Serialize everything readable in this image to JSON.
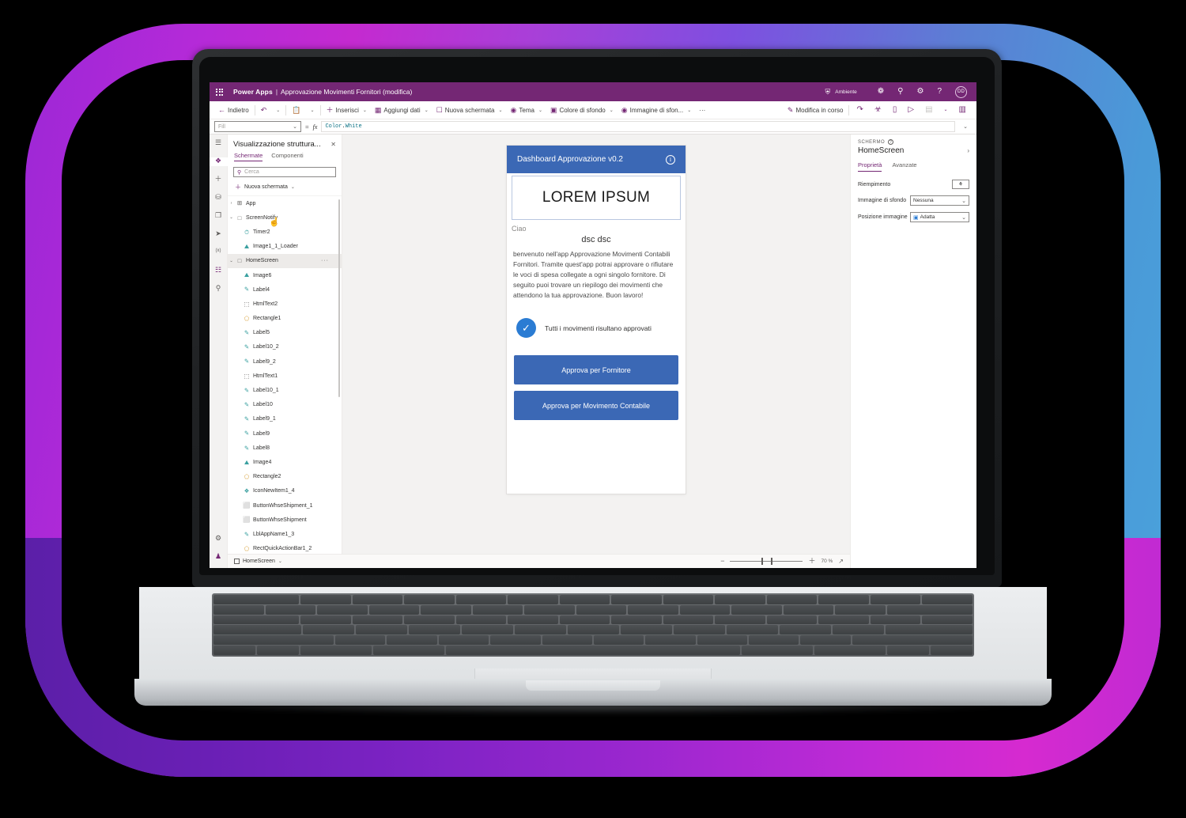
{
  "header": {
    "waffle_icon": "app-launcher-icon",
    "brand": "Power Apps",
    "separator": "|",
    "app_name": "Approvazione Movimenti Fornitori (modifica)",
    "environment_label": "Ambiente",
    "environment_icon": "environment-icon",
    "icons": [
      {
        "name": "power-platform-icon",
        "glyph": "❁"
      },
      {
        "name": "notification-bell-icon",
        "glyph": "ὑ4"
      },
      {
        "name": "settings-gear-icon",
        "glyph": "⚙"
      },
      {
        "name": "help-question-icon",
        "glyph": "?"
      }
    ],
    "avatar_initials": "DD"
  },
  "toolbar": {
    "back_label": "Indietro",
    "undo_icon": "undo-icon",
    "paste_icon": "clipboard-icon",
    "insert_label": "Inserisci",
    "add_data_label": "Aggiungi dati",
    "new_screen_label": "Nuova schermata",
    "theme_label": "Tema",
    "background_color_label": "Colore di sfondo",
    "background_image_label": "Immagine di sfon...",
    "overflow_label": "···",
    "editing_label": "Modifica in corso",
    "right_icons": [
      {
        "name": "share-icon",
        "glyph": "↪"
      },
      {
        "name": "app-checker-icon",
        "glyph": "☸"
      },
      {
        "name": "comments-icon",
        "glyph": "▭"
      },
      {
        "name": "preview-play-icon",
        "glyph": "▷"
      },
      {
        "name": "save-icon",
        "glyph": "▤"
      },
      {
        "name": "chevron-down-icon",
        "glyph": "⌄"
      },
      {
        "name": "publish-icon",
        "glyph": "▥"
      }
    ]
  },
  "formula_bar": {
    "property_value": "Fill",
    "equals": "=",
    "fx": "fx",
    "formula_prefix": "Color",
    "formula_dot": ".",
    "formula_suffix": "White",
    "chevron": "⌄"
  },
  "rail": {
    "items": [
      {
        "name": "hamburger-menu-icon",
        "glyph": "☰",
        "selected": false
      },
      {
        "name": "tree-view-icon",
        "glyph": "❖",
        "selected": true
      },
      {
        "name": "insert-plus-icon",
        "glyph": "＋",
        "selected": false
      },
      {
        "name": "data-icon",
        "glyph": "⛁",
        "selected": false
      },
      {
        "name": "media-icon",
        "glyph": "❐",
        "selected": false
      },
      {
        "name": "power-automate-icon",
        "glyph": "➤",
        "selected": false
      },
      {
        "name": "variables-icon",
        "glyph": "(x)",
        "selected": false
      },
      {
        "name": "app-checker-icon",
        "glyph": "☷",
        "selected": false
      },
      {
        "name": "search-icon",
        "glyph": "⚲",
        "selected": false
      }
    ],
    "bottom_items": [
      {
        "name": "settings-gear-icon",
        "glyph": "⚙"
      },
      {
        "name": "account-icon",
        "glyph": "♟"
      }
    ]
  },
  "tree": {
    "title": "Visualizzazione struttura...",
    "close_icon": "close-icon",
    "tabs": [
      {
        "label": "Schermate",
        "selected": true
      },
      {
        "label": "Componenti",
        "selected": false
      }
    ],
    "search_placeholder": "Cerca",
    "new_screen_label": "Nuova schermata",
    "nodes": [
      {
        "label": "App",
        "icon": "app-icon",
        "glyph": "⊞",
        "chevron": "›",
        "indent": 0,
        "selected": false
      },
      {
        "label": "ScreenNotify",
        "icon": "screen-icon",
        "glyph": "□",
        "chevron": "⌄",
        "indent": 0,
        "selected": false
      },
      {
        "label": "Timer2",
        "icon": "timer-icon",
        "glyph": "⏱",
        "chevron": "",
        "indent": 1,
        "selected": false
      },
      {
        "label": "Image1_1_Loader",
        "icon": "image-icon",
        "glyph": "⛰",
        "chevron": "",
        "indent": 1,
        "selected": false
      },
      {
        "label": "HomeScreen",
        "icon": "screen-icon",
        "glyph": "□",
        "chevron": "⌄",
        "indent": 0,
        "selected": true
      },
      {
        "label": "Image6",
        "icon": "image-icon",
        "glyph": "⛰",
        "chevron": "",
        "indent": 1,
        "selected": false
      },
      {
        "label": "Label4",
        "icon": "label-icon",
        "glyph": "✎",
        "chevron": "",
        "indent": 1,
        "selected": false
      },
      {
        "label": "HtmlText2",
        "icon": "html-text-icon",
        "glyph": "⬚",
        "chevron": "",
        "indent": 1,
        "selected": false
      },
      {
        "label": "Rectangle1",
        "icon": "shape-icon",
        "glyph": "⬠",
        "chevron": "",
        "indent": 1,
        "selected": false
      },
      {
        "label": "Label5",
        "icon": "label-icon",
        "glyph": "✎",
        "chevron": "",
        "indent": 1,
        "selected": false
      },
      {
        "label": "Label10_2",
        "icon": "label-icon",
        "glyph": "✎",
        "chevron": "",
        "indent": 1,
        "selected": false
      },
      {
        "label": "Label9_2",
        "icon": "label-icon",
        "glyph": "✎",
        "chevron": "",
        "indent": 1,
        "selected": false
      },
      {
        "label": "HtmlText1",
        "icon": "html-text-icon",
        "glyph": "⬚",
        "chevron": "",
        "indent": 1,
        "selected": false
      },
      {
        "label": "Label10_1",
        "icon": "label-icon",
        "glyph": "✎",
        "chevron": "",
        "indent": 1,
        "selected": false
      },
      {
        "label": "Label10",
        "icon": "label-icon",
        "glyph": "✎",
        "chevron": "",
        "indent": 1,
        "selected": false
      },
      {
        "label": "Label9_1",
        "icon": "label-icon",
        "glyph": "✎",
        "chevron": "",
        "indent": 1,
        "selected": false
      },
      {
        "label": "Label9",
        "icon": "label-icon",
        "glyph": "✎",
        "chevron": "",
        "indent": 1,
        "selected": false
      },
      {
        "label": "Label8",
        "icon": "label-icon",
        "glyph": "✎",
        "chevron": "",
        "indent": 1,
        "selected": false
      },
      {
        "label": "Image4",
        "icon": "image-icon",
        "glyph": "⛰",
        "chevron": "",
        "indent": 1,
        "selected": false
      },
      {
        "label": "Rectangle2",
        "icon": "shape-icon",
        "glyph": "⬠",
        "chevron": "",
        "indent": 1,
        "selected": false
      },
      {
        "label": "IconNewItem1_4",
        "icon": "icon-component-icon",
        "glyph": "❖",
        "chevron": "",
        "indent": 1,
        "selected": false
      },
      {
        "label": "ButtonWhseShipment_1",
        "icon": "button-icon",
        "glyph": "⬜",
        "chevron": "",
        "indent": 1,
        "selected": false
      },
      {
        "label": "ButtonWhseShipment",
        "icon": "button-icon",
        "glyph": "⬜",
        "chevron": "",
        "indent": 1,
        "selected": false
      },
      {
        "label": "LblAppName1_3",
        "icon": "label-icon",
        "glyph": "✎",
        "chevron": "",
        "indent": 1,
        "selected": false
      },
      {
        "label": "RectQuickActionBar1_2",
        "icon": "shape-icon",
        "glyph": "⬠",
        "chevron": "",
        "indent": 1,
        "selected": false
      }
    ]
  },
  "canvas": {
    "app_bar_title": "Dashboard Approvazione v0.2",
    "info_icon": "info-icon",
    "hero_text": "LOREM IPSUM",
    "greeting": "Ciao",
    "user_name": "dsc dsc",
    "body_text": "benvenuto nell'app Approvazione Movimenti Contabili Fornitori. Tramite quest'app potrai approvare o rifiutare le voci di spesa collegate a ogni singolo fornitore. Di seguito puoi trovare un riepilogo dei movimenti che attendono la tua approvazione. Buon lavoro!",
    "status_icon": "check-circle-icon",
    "status_text": "Tutti i movimenti risultano approvati",
    "buttons": [
      {
        "label": "Approva per Fornitore"
      },
      {
        "label": "Approva per Movimento Contabile"
      }
    ],
    "accent_blue": "#3b68b5",
    "check_blue": "#2b7cd3"
  },
  "properties": {
    "kicker": "SCHERMO",
    "help_icon": "help-icon",
    "title": "HomeScreen",
    "expand_icon": "chevron-right-icon",
    "tabs": [
      {
        "label": "Proprietà",
        "selected": true
      },
      {
        "label": "Avanzate",
        "selected": false
      }
    ],
    "rows": [
      {
        "label": "Riempimento",
        "control": "color-swatch",
        "value": ""
      },
      {
        "label": "Immagine di sfondo",
        "control": "dropdown",
        "value": "Nessuna"
      },
      {
        "label": "Posizione immagine",
        "control": "dropdown",
        "value": "Adatta",
        "icon": "image-icon"
      }
    ]
  },
  "statusbar": {
    "screen_name": "HomeScreen",
    "screen_chevron": "⌄",
    "zoom_minus": "−",
    "zoom_plus": "＋",
    "zoom_value": "70 %",
    "fullscreen_icon": "fit-screen-icon"
  },
  "theme": {
    "brand_purple": "#742774",
    "canvas_grey": "#f3f2f1",
    "frame_gradient_start": "#9c27d6",
    "frame_gradient_end": "#4aa3dc"
  }
}
